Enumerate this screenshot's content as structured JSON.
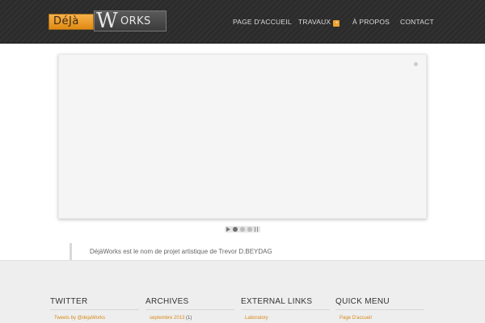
{
  "header": {
    "logo": {
      "part1": "DéJà",
      "part2_big": "W",
      "part2_rest": "ORKS"
    },
    "nav": {
      "home": "PAGE D'ACCUEIL",
      "works": "TRAVAUX",
      "works_badge": "+",
      "about": "À PROPOS",
      "contact": "CONTACT"
    }
  },
  "quote": {
    "text": "DéjàWorks est le nom de projet artistique de Trevor D.BEYDAG"
  },
  "footer": {
    "twitter": {
      "title": "TWITTER",
      "link": "Tweets by @dejaWorks"
    },
    "archives": {
      "title": "ARCHIVES",
      "link": "septembre 2013",
      "count": "(1)"
    },
    "external": {
      "title": "EXTERNAL LINKS",
      "link": "Laboratory"
    },
    "quick": {
      "title": "QUICK MENU",
      "link": "Page D'accueil"
    }
  },
  "colors": {
    "header_bg": "#2b2b2b",
    "accent": "#f0a22e",
    "footer_bg": "#eeeeee",
    "link": "#d7891a"
  },
  "icons": [
    "dropdown-plus-icon",
    "play-icon",
    "pause-icon"
  ]
}
